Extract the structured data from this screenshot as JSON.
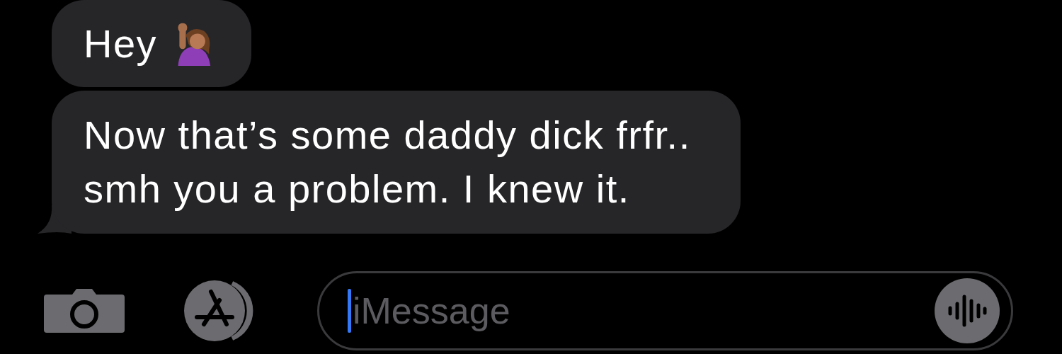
{
  "messages": [
    {
      "text": "Hey",
      "kind": "with_icon",
      "tail": false
    },
    {
      "text": "Now that’s some daddy dick frfr..\nsmh you a problem. I knew it.",
      "kind": "plain",
      "tail": true
    }
  ],
  "composer": {
    "placeholder": "iMessage"
  }
}
